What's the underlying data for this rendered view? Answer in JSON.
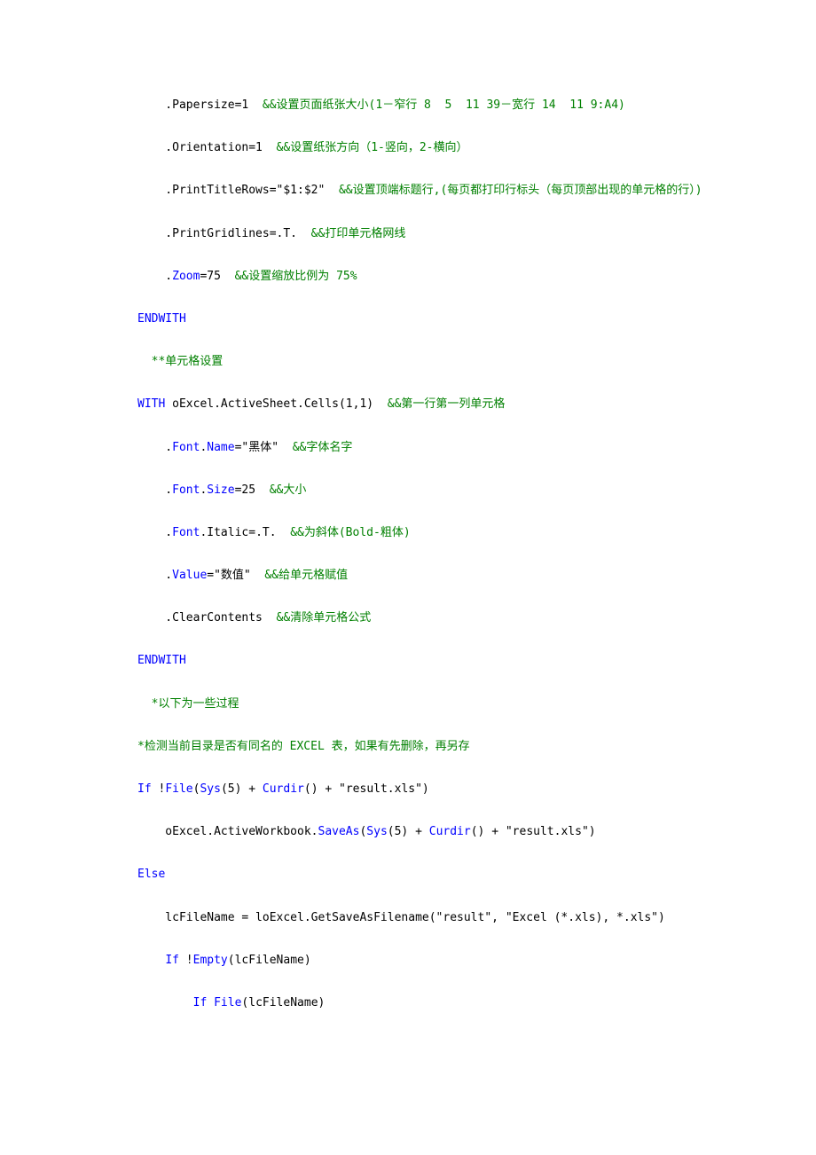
{
  "lines": {
    "l01_a": "    .Papersize=1  ",
    "l01_c": "&&设置页面纸张大小(1－窄行 8  5  11 39－宽行 14  11 9:A4)",
    "l02_a": "    .Orientation=1  ",
    "l02_c": "&&设置纸张方向（1-竖向，2-横向）",
    "l03_a": "    .PrintTitleRows=\"$1:$2\"  ",
    "l03_c": "&&设置顶端标题行,(每页都打印行标头（每页顶部出现的单元格的行）)",
    "l04_a": "    .PrintGridlines=.T.  ",
    "l04_c": "&&打印单元格网线",
    "l05_a": "    .",
    "l05_b": "Zoom",
    "l05_c": "=75  ",
    "l05_d": "&&设置缩放比例为 75%",
    "l06": "ENDWITH",
    "l07": "  **单元格设置",
    "l08_a": "WITH",
    "l08_b": " oExcel.ActiveSheet.Cells(1,1)  ",
    "l08_c": "&&第一行第一列单元格",
    "l09_a": "    .",
    "l09_b": "Font",
    "l09_c": ".",
    "l09_d": "Name",
    "l09_e": "=\"黑体\"  ",
    "l09_f": "&&字体名字",
    "l10_a": "    .",
    "l10_b": "Font",
    "l10_c": ".",
    "l10_d": "Size",
    "l10_e": "=25  ",
    "l10_f": "&&大小",
    "l11_a": "    .",
    "l11_b": "Font",
    "l11_c": ".Italic=.T.  ",
    "l11_d": "&&为斜体(Bold-粗体)",
    "l12_a": "    .",
    "l12_b": "Value",
    "l12_c": "=\"数值\"  ",
    "l12_d": "&&给单元格赋值",
    "l13_a": "    .ClearContents  ",
    "l13_b": "&&清除单元格公式",
    "l14": "ENDWITH",
    "l15": "  *以下为一些过程",
    "l16": "*检测当前目录是否有同名的 EXCEL 表，如果有先删除，再另存",
    "l17_a": "If",
    "l17_b": " !",
    "l17_c": "File",
    "l17_d": "(",
    "l17_e": "Sys",
    "l17_f": "(5) + ",
    "l17_g": "Curdir",
    "l17_h": "() + \"result.xls\")",
    "l18_a": "    oExcel.ActiveWorkbook.",
    "l18_b": "SaveAs",
    "l18_c": "(",
    "l18_d": "Sys",
    "l18_e": "(5) + ",
    "l18_f": "Curdir",
    "l18_g": "() + \"result.xls\")",
    "l19": "Else",
    "l20": "    lcFileName = loExcel.GetSaveAsFilename(\"result\", \"Excel (*.xls), *.xls\")",
    "l21_a": "    ",
    "l21_b": "If",
    "l21_c": " !",
    "l21_d": "Empty",
    "l21_e": "(lcFileName)",
    "l22_a": "        ",
    "l22_b": "If File",
    "l22_c": "(lcFileName)"
  }
}
